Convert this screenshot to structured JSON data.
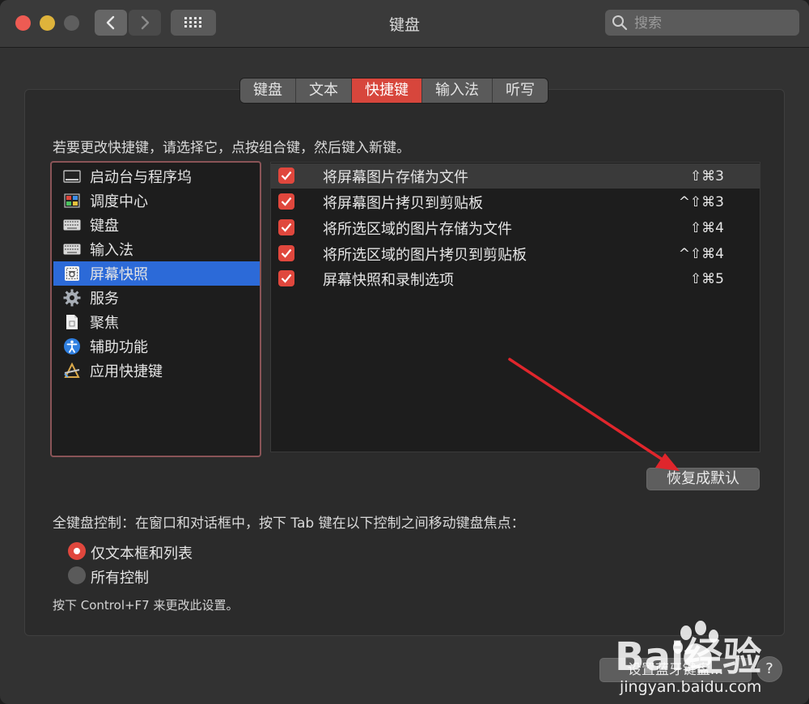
{
  "window": {
    "title": "键盘"
  },
  "search": {
    "placeholder": "搜索"
  },
  "tabs": [
    {
      "label": "键盘"
    },
    {
      "label": "文本"
    },
    {
      "label": "快捷键",
      "active": true
    },
    {
      "label": "输入法"
    },
    {
      "label": "听写"
    }
  ],
  "instruction": "若要更改快捷键，请选择它，点按组合键，然后键入新键。",
  "categories": [
    {
      "label": "启动台与程序坞",
      "icon": "dock-icon"
    },
    {
      "label": "调度中心",
      "icon": "mission-control-icon"
    },
    {
      "label": "键盘",
      "icon": "keyboard-icon"
    },
    {
      "label": "输入法",
      "icon": "input-keyboard-icon"
    },
    {
      "label": "屏幕快照",
      "icon": "screenshot-icon",
      "selected": true
    },
    {
      "label": "服务",
      "icon": "gear-icon"
    },
    {
      "label": "聚焦",
      "icon": "document-icon"
    },
    {
      "label": "辅助功能",
      "icon": "accessibility-icon"
    },
    {
      "label": "应用快捷键",
      "icon": "app-shortcut-icon"
    }
  ],
  "shortcuts": [
    {
      "label": "将屏幕图片存储为文件",
      "key": "⇧⌘3",
      "checked": true
    },
    {
      "label": "将屏幕图片拷贝到剪贴板",
      "key": "^⇧⌘3",
      "checked": true
    },
    {
      "label": "将所选区域的图片存储为文件",
      "key": "⇧⌘4",
      "checked": true
    },
    {
      "label": "将所选区域的图片拷贝到剪贴板",
      "key": "^⇧⌘4",
      "checked": true
    },
    {
      "label": "屏幕快照和录制选项",
      "key": "⇧⌘5",
      "checked": true
    }
  ],
  "restore_button": "恢复成默认",
  "full_keyboard": {
    "label": "全键盘控制：在窗口和对话框中，按下 Tab 键在以下控制之间移动键盘焦点：",
    "options": [
      {
        "label": "仅文本框和列表",
        "selected": true
      },
      {
        "label": "所有控制",
        "selected": false
      }
    ],
    "hint": "按下 Control+F7 来更改此设置。"
  },
  "bluetooth_button": "设置蓝牙键盘...",
  "help_button": "?",
  "watermark": {
    "brand": "Bai经验",
    "url": "jingyan.baidu.com"
  },
  "colors": {
    "accent": "#e0473d",
    "selection": "#2c6ad8",
    "annotation_arrow": "#e0262c"
  }
}
